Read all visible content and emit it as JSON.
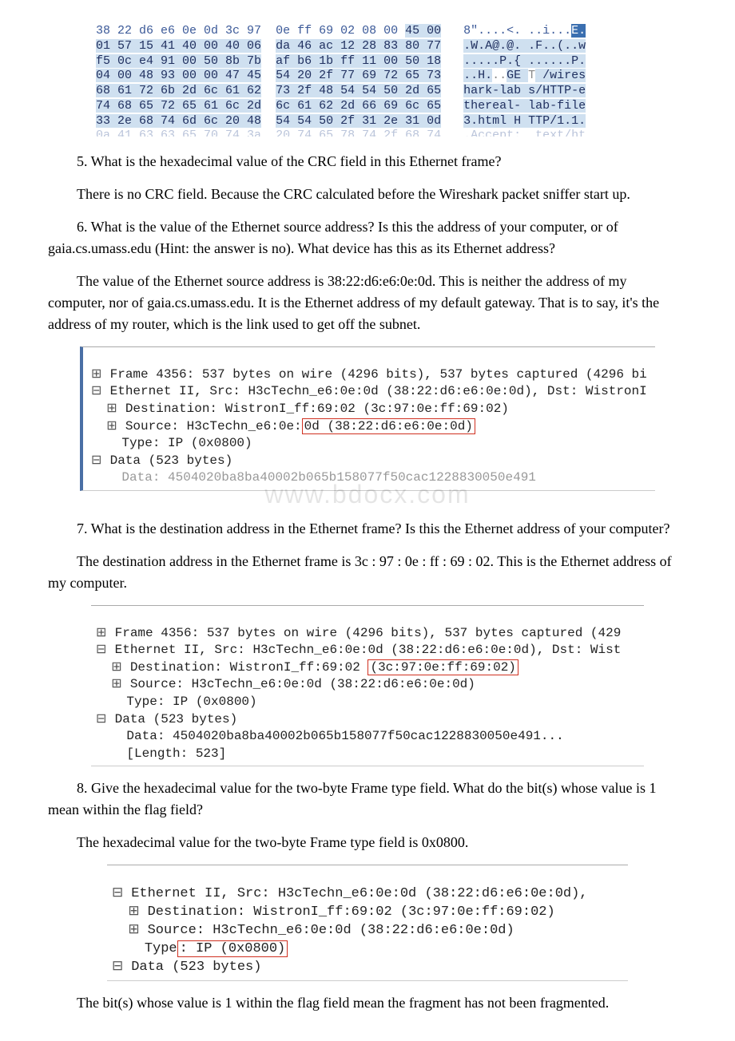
{
  "hexdump": {
    "rows": [
      {
        "l": "38 22 d6 e6 0e 0d 3c 97",
        "r": "0e ff 69 02 08 00 45 00",
        "ascii_pre": "8\"....<. ..i...",
        "ascii_e": "E.",
        "hl_last": true,
        "hl_ascii_last": true
      },
      {
        "l": "01 57 15 41 40 00 40 06",
        "r": "da 46 ac 12 28 83 80 77",
        "ascii": ".W.A@.@. .F..(..w",
        "hl": true
      },
      {
        "l": "f5 0c e4 91 00 50 8b 7b",
        "r": "af b6 1b ff 11 00 50 18",
        "ascii": ".....P.{ ......P.",
        "hl": true
      },
      {
        "l": "04 00 48 93 00 00 47 45",
        "r": "54 20 2f 77 69 72 65 73",
        "ascii": "..H...GE T /wires",
        "hl": true,
        "ge_split": true
      },
      {
        "l": "68 61 72 6b 2d 6c 61 62",
        "r": "73 2f 48 54 54 50 2d 65",
        "ascii": "hark-lab s/HTTP-e",
        "hl": true
      },
      {
        "l": "74 68 65 72 65 61 6c 2d",
        "r": "6c 61 62 2d 66 69 6c 65",
        "ascii": "thereal- lab-file",
        "hl": true
      },
      {
        "l": "33 2e 68 74 6d 6c 20 48",
        "r": "54 54 50 2f 31 2e 31 0d",
        "ascii": "3.html H TTP/1.1.",
        "hl": true
      },
      {
        "l": "0a 41 63 63 65 70 74 3a",
        "r": "20 74 65 78 74 2f 68 74",
        "ascii": ".Accept:  text/ht",
        "faded": true
      }
    ]
  },
  "q5": {
    "question": "5. What is the hexadecimal value of the CRC field in this Ethernet frame?",
    "answer": "There is no CRC field. Because the CRC calculated before the Wireshark packet sniffer start up."
  },
  "q6": {
    "question": "6. What is the value of the Ethernet source address? Is this the address of your computer, or of gaia.cs.umass.edu (Hint: the answer is no). What device has this as its Ethernet address?",
    "answer": "The value of the Ethernet source address is 38:22:d6:e6:0e:0d. This is neither the address of my computer, nor of gaia.cs.umass.edu. It is the Ethernet address of my default gateway. That is to say, it's the address of my router, which is the link used to get off the subnet."
  },
  "ws1": {
    "frame": "Frame 4356: 537 bytes on wire (4296 bits), 537 bytes captured (4296 bi",
    "eth": "Ethernet II, Src: H3cTechn_e6:0e:0d (38:22:d6:e6:0e:0d), Dst: WistronI",
    "dest": "Destination: WistronI_ff:69:02 (3c:97:0e:ff:69:02)",
    "src_pre": "Source: H3cTechn_e6:0e:",
    "src_box": "0d (38:22:d6:e6:0e:0d)",
    "type": "Type: IP (0x0800)",
    "data": "Data (523 bytes)",
    "dataline": "Data: 4504020ba8ba40002b065b158077f50cac1228830050e491"
  },
  "watermark": "www.bdocx.com",
  "q7": {
    "question": "7. What is the destination address in the Ethernet frame? Is this the Ethernet address of your computer?",
    "answer": "The destination address in the Ethernet frame is 3c : 97 : 0e : ff : 69 : 02. This is the Ethernet address of my computer."
  },
  "ws2": {
    "frame": "Frame 4356: 537 bytes on wire (4296 bits), 537 bytes captured (429",
    "eth": "Ethernet II, Src: H3cTechn_e6:0e:0d (38:22:d6:e6:0e:0d), Dst: Wist",
    "dest_pre": "Destination: WistronI_ff:69:02 ",
    "dest_box": "(3c:97:0e:ff:69:02)",
    "src": "Source: H3cTechn_e6:0e:0d (38:22:d6:e6:0e:0d)",
    "type": "Type: IP (0x0800)",
    "data": "Data (523 bytes)",
    "dataline": "Data: 4504020ba8ba40002b065b158077f50cac1228830050e491...",
    "length": "[Length: 523]"
  },
  "q8": {
    "question": "8. Give the hexadecimal value for the two-byte Frame type field. What do the bit(s) whose value is 1 mean within the flag field?",
    "answer1": "The hexadecimal value for the two-byte Frame type field is 0x0800.",
    "answer2": "The bit(s) whose value is 1 within the flag field mean the fragment has not been fragmented."
  },
  "ws3": {
    "eth": "Ethernet II, Src: H3cTechn_e6:0e:0d (38:22:d6:e6:0e:0d),",
    "dest": "Destination: WistronI_ff:69:02 (3c:97:0e:ff:69:02)",
    "src": "Source: H3cTechn_e6:0e:0d (38:22:d6:e6:0e:0d)",
    "type_pre": "Type",
    "type_box": ": IP (0x0800)",
    "data": "Data (523 bytes)"
  }
}
